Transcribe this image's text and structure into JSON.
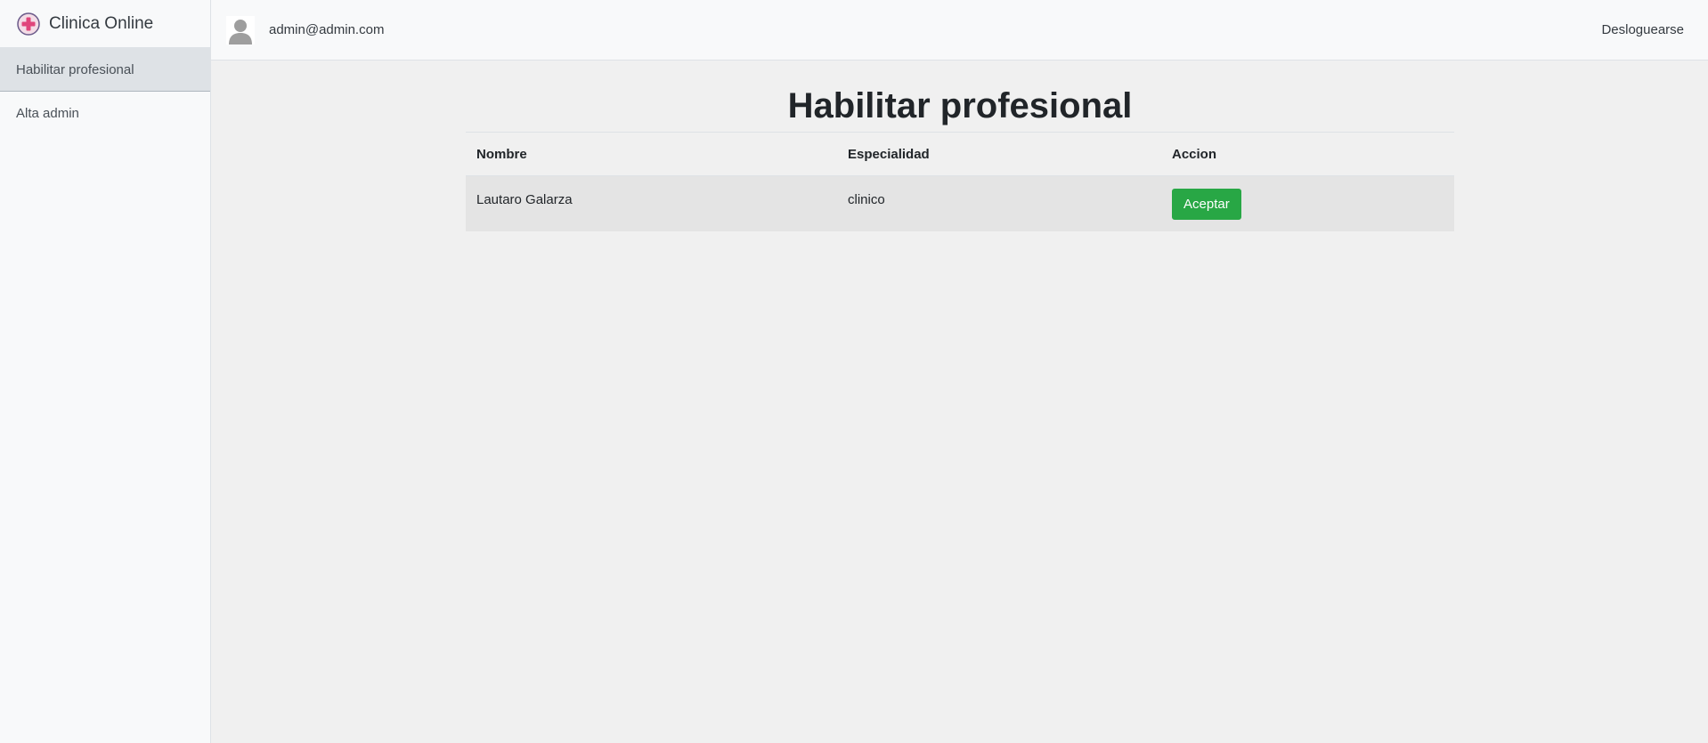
{
  "brand": {
    "name": "Clinica Online",
    "icon": "medical-cross-icon"
  },
  "sidebar": {
    "items": [
      {
        "label": "Habilitar profesional",
        "active": true
      },
      {
        "label": "Alta admin",
        "active": false
      }
    ]
  },
  "topbar": {
    "avatar_icon": "user-avatar-icon",
    "user_email": "admin@admin.com",
    "logout_label": "Desloguearse"
  },
  "main": {
    "title": "Habilitar profesional",
    "table": {
      "headers": [
        "Nombre",
        "Especialidad",
        "Accion"
      ],
      "rows": [
        {
          "nombre": "Lautaro Galarza",
          "especialidad": "clinico",
          "action_label": "Aceptar"
        }
      ]
    }
  },
  "colors": {
    "accept_button": "#28a745",
    "sidebar_bg": "#f8f9fa",
    "main_bg": "#f0f0f0",
    "logo_cross": "#e0457b"
  }
}
